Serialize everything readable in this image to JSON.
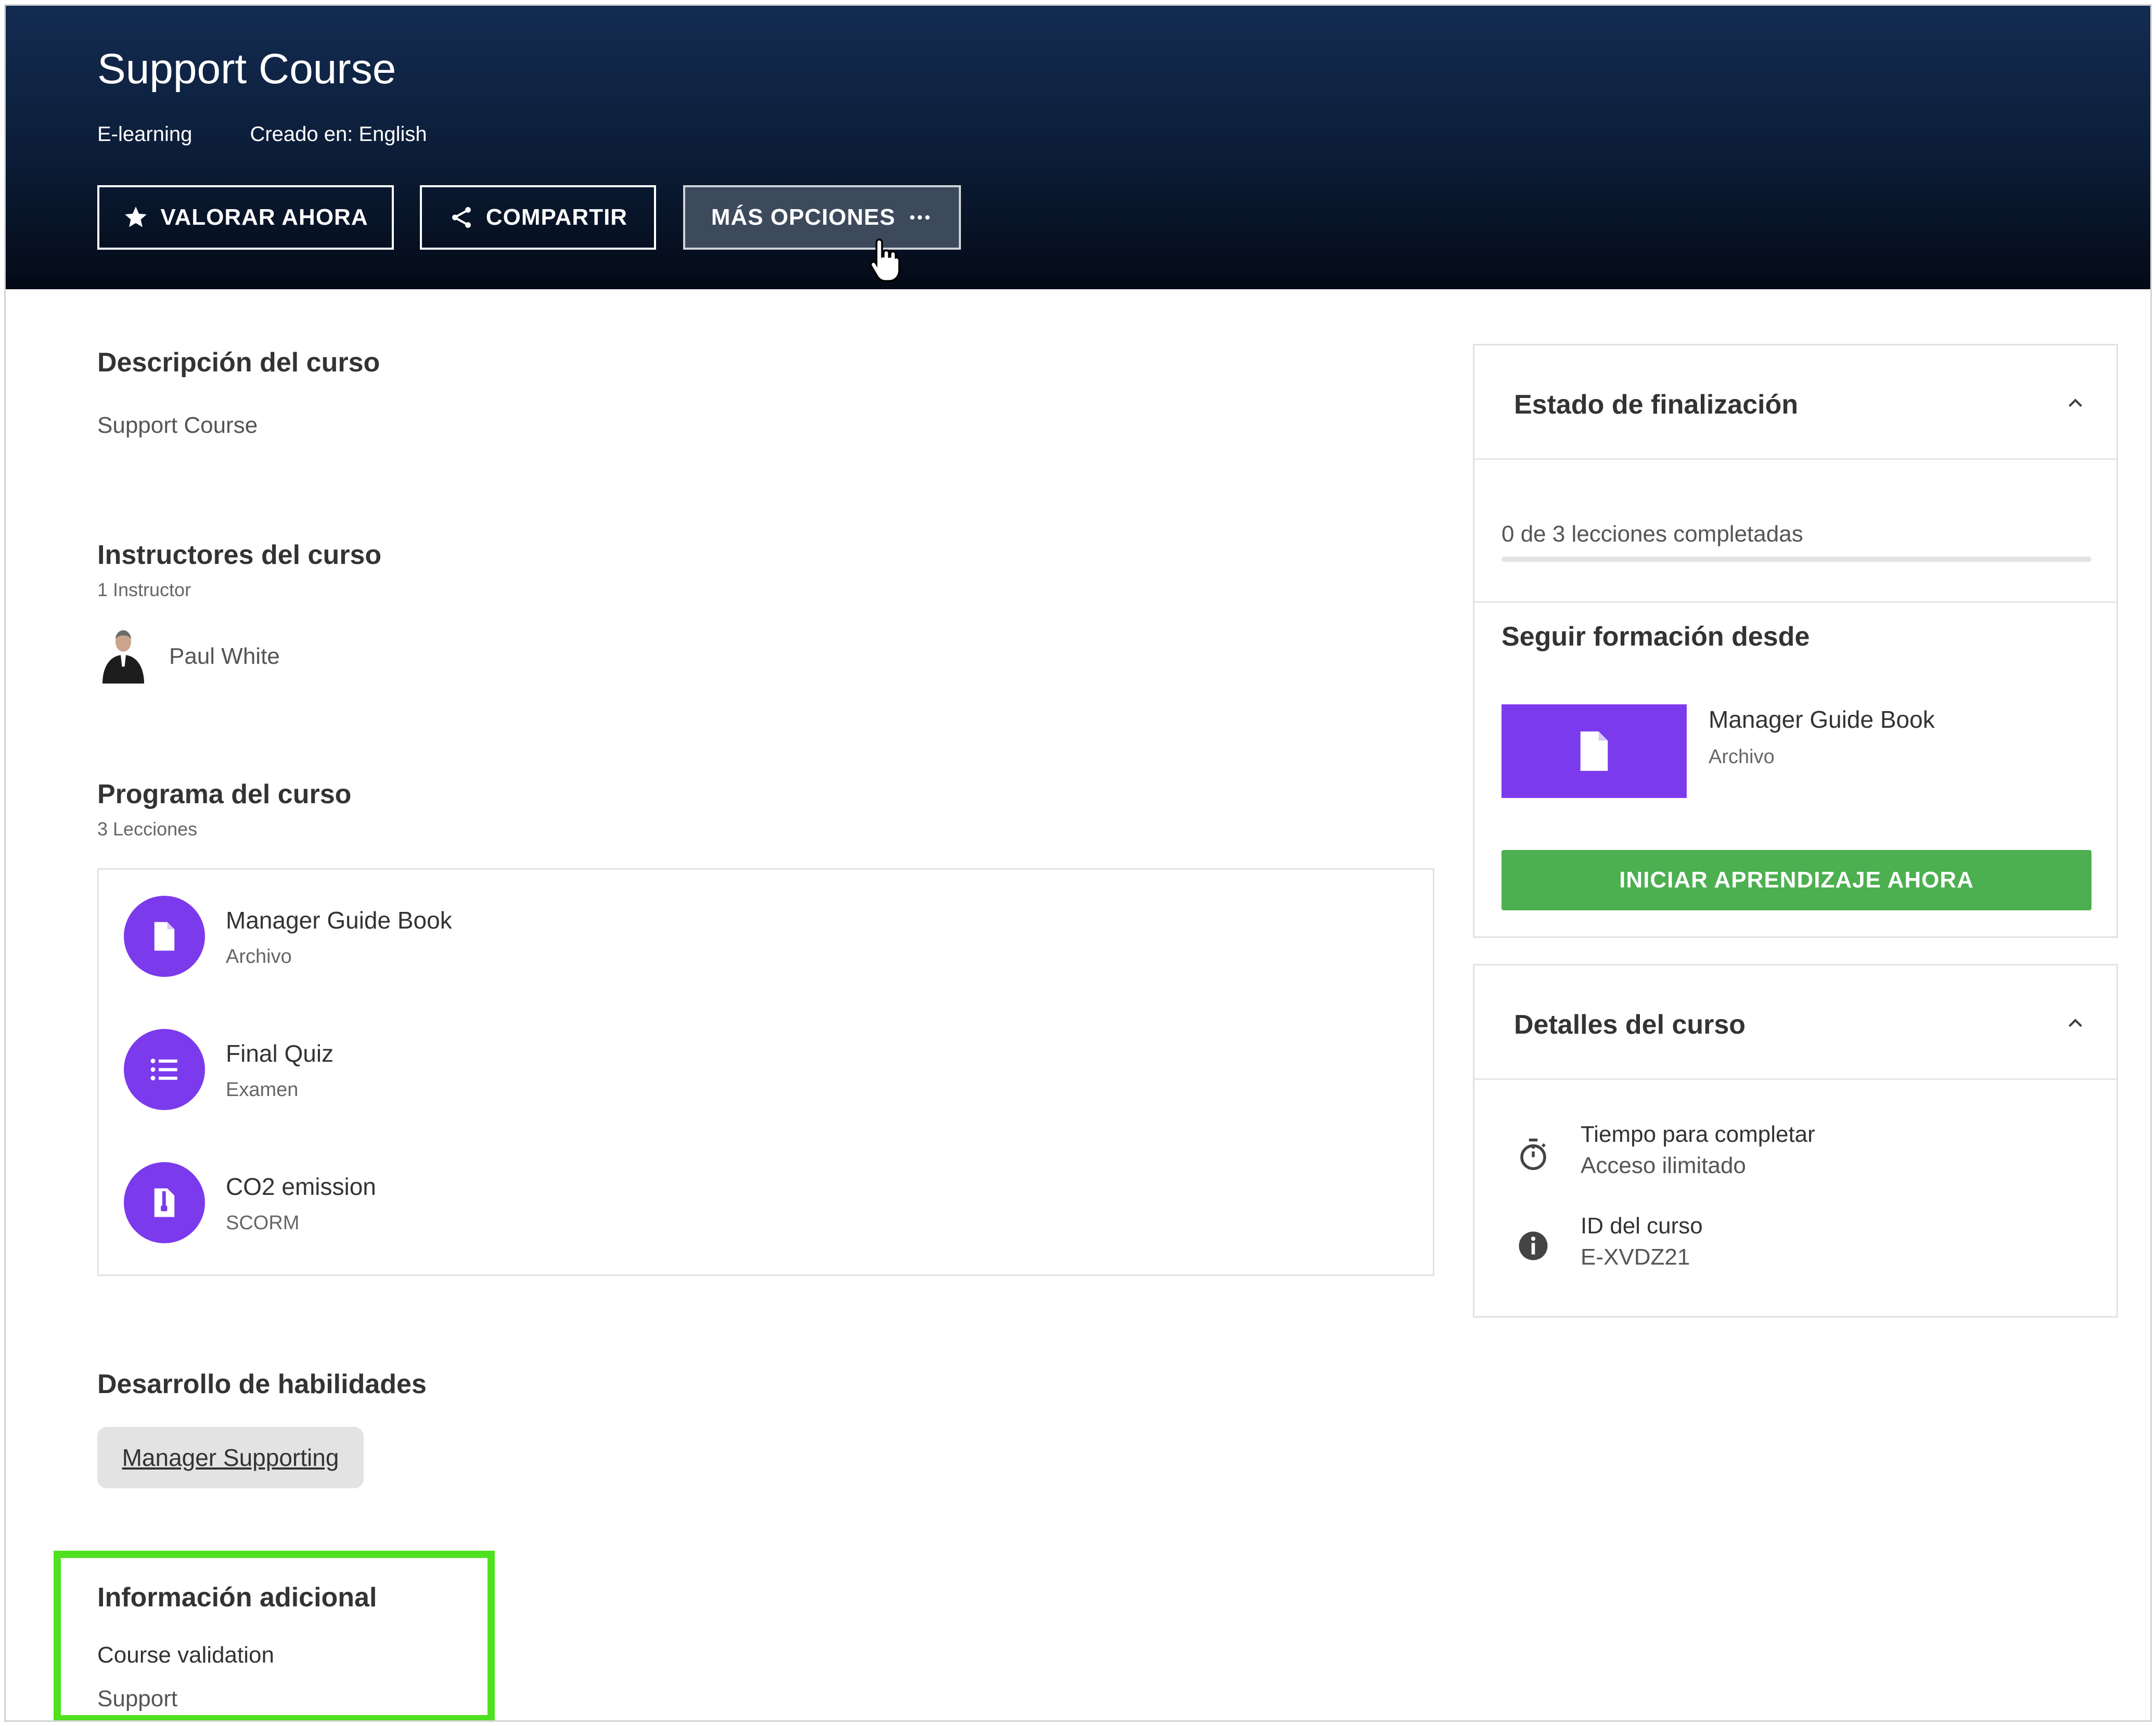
{
  "header": {
    "title": "Support Course",
    "type": "E-learning",
    "created_in": "Creado en: English",
    "buttons": {
      "rate": "VALORAR AHORA",
      "share": "COMPARTIR",
      "more": "MÁS OPCIONES"
    }
  },
  "description": {
    "heading": "Descripción del curso",
    "text": "Support Course"
  },
  "instructors": {
    "heading": "Instructores del curso",
    "count": "1 Instructor",
    "names": [
      "Paul White"
    ]
  },
  "program": {
    "heading": "Programa del curso",
    "count": "3 Lecciones",
    "lessons": [
      {
        "title": "Manager Guide Book",
        "type": "Archivo",
        "icon": "document-icon"
      },
      {
        "title": "Final Quiz",
        "type": "Examen",
        "icon": "list-icon"
      },
      {
        "title": "CO2 emission",
        "type": "SCORM",
        "icon": "scorm-package-icon"
      }
    ]
  },
  "skills": {
    "heading": "Desarrollo de habilidades",
    "items": [
      "Manager Supporting"
    ]
  },
  "additional": {
    "heading": "Información adicional",
    "field_label": "Course validation",
    "field_value": "Support"
  },
  "completion": {
    "heading": "Estado de finalización",
    "progress_text": "0 de 3 lecciones completadas",
    "progress": 0,
    "continue_heading": "Seguir formación desde",
    "continue_item": {
      "title": "Manager Guide Book",
      "type": "Archivo"
    },
    "start_button": "INICIAR APRENDIZAJE AHORA"
  },
  "details": {
    "heading": "Detalles del curso",
    "time_label": "Tiempo para completar",
    "time_value": "Acceso ilimitado",
    "id_label": "ID del curso",
    "id_value": "E-XVDZ21"
  },
  "colors": {
    "accent": "#7c3aed",
    "start_button": "#4caf50",
    "highlight": "#4fe01f",
    "header_top": "#142c52",
    "header_bottom": "#040a16"
  }
}
